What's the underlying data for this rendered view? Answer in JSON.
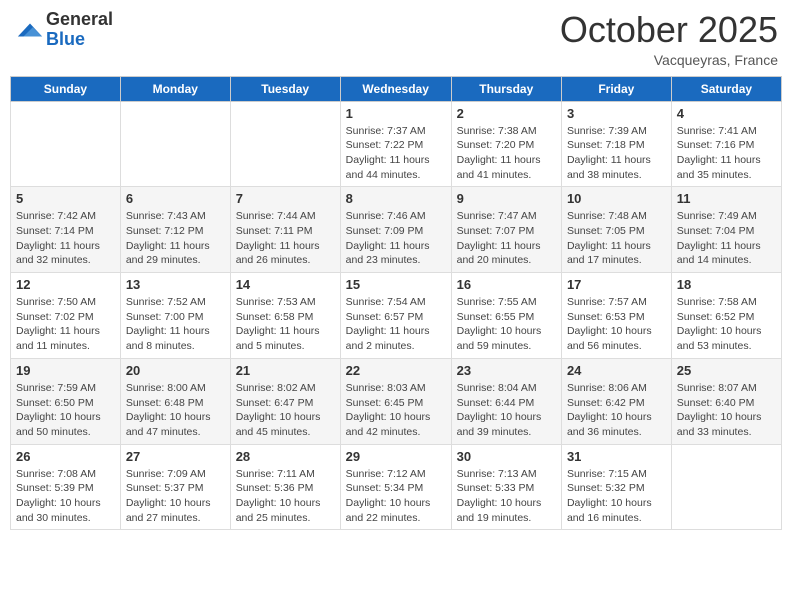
{
  "logo": {
    "general": "General",
    "blue": "Blue"
  },
  "header": {
    "month": "October 2025",
    "location": "Vacqueyras, France"
  },
  "weekdays": [
    "Sunday",
    "Monday",
    "Tuesday",
    "Wednesday",
    "Thursday",
    "Friday",
    "Saturday"
  ],
  "weeks": [
    [
      {
        "day": "",
        "info": ""
      },
      {
        "day": "",
        "info": ""
      },
      {
        "day": "",
        "info": ""
      },
      {
        "day": "1",
        "info": "Sunrise: 7:37 AM\nSunset: 7:22 PM\nDaylight: 11 hours and 44 minutes."
      },
      {
        "day": "2",
        "info": "Sunrise: 7:38 AM\nSunset: 7:20 PM\nDaylight: 11 hours and 41 minutes."
      },
      {
        "day": "3",
        "info": "Sunrise: 7:39 AM\nSunset: 7:18 PM\nDaylight: 11 hours and 38 minutes."
      },
      {
        "day": "4",
        "info": "Sunrise: 7:41 AM\nSunset: 7:16 PM\nDaylight: 11 hours and 35 minutes."
      }
    ],
    [
      {
        "day": "5",
        "info": "Sunrise: 7:42 AM\nSunset: 7:14 PM\nDaylight: 11 hours and 32 minutes."
      },
      {
        "day": "6",
        "info": "Sunrise: 7:43 AM\nSunset: 7:12 PM\nDaylight: 11 hours and 29 minutes."
      },
      {
        "day": "7",
        "info": "Sunrise: 7:44 AM\nSunset: 7:11 PM\nDaylight: 11 hours and 26 minutes."
      },
      {
        "day": "8",
        "info": "Sunrise: 7:46 AM\nSunset: 7:09 PM\nDaylight: 11 hours and 23 minutes."
      },
      {
        "day": "9",
        "info": "Sunrise: 7:47 AM\nSunset: 7:07 PM\nDaylight: 11 hours and 20 minutes."
      },
      {
        "day": "10",
        "info": "Sunrise: 7:48 AM\nSunset: 7:05 PM\nDaylight: 11 hours and 17 minutes."
      },
      {
        "day": "11",
        "info": "Sunrise: 7:49 AM\nSunset: 7:04 PM\nDaylight: 11 hours and 14 minutes."
      }
    ],
    [
      {
        "day": "12",
        "info": "Sunrise: 7:50 AM\nSunset: 7:02 PM\nDaylight: 11 hours and 11 minutes."
      },
      {
        "day": "13",
        "info": "Sunrise: 7:52 AM\nSunset: 7:00 PM\nDaylight: 11 hours and 8 minutes."
      },
      {
        "day": "14",
        "info": "Sunrise: 7:53 AM\nSunset: 6:58 PM\nDaylight: 11 hours and 5 minutes."
      },
      {
        "day": "15",
        "info": "Sunrise: 7:54 AM\nSunset: 6:57 PM\nDaylight: 11 hours and 2 minutes."
      },
      {
        "day": "16",
        "info": "Sunrise: 7:55 AM\nSunset: 6:55 PM\nDaylight: 10 hours and 59 minutes."
      },
      {
        "day": "17",
        "info": "Sunrise: 7:57 AM\nSunset: 6:53 PM\nDaylight: 10 hours and 56 minutes."
      },
      {
        "day": "18",
        "info": "Sunrise: 7:58 AM\nSunset: 6:52 PM\nDaylight: 10 hours and 53 minutes."
      }
    ],
    [
      {
        "day": "19",
        "info": "Sunrise: 7:59 AM\nSunset: 6:50 PM\nDaylight: 10 hours and 50 minutes."
      },
      {
        "day": "20",
        "info": "Sunrise: 8:00 AM\nSunset: 6:48 PM\nDaylight: 10 hours and 47 minutes."
      },
      {
        "day": "21",
        "info": "Sunrise: 8:02 AM\nSunset: 6:47 PM\nDaylight: 10 hours and 45 minutes."
      },
      {
        "day": "22",
        "info": "Sunrise: 8:03 AM\nSunset: 6:45 PM\nDaylight: 10 hours and 42 minutes."
      },
      {
        "day": "23",
        "info": "Sunrise: 8:04 AM\nSunset: 6:44 PM\nDaylight: 10 hours and 39 minutes."
      },
      {
        "day": "24",
        "info": "Sunrise: 8:06 AM\nSunset: 6:42 PM\nDaylight: 10 hours and 36 minutes."
      },
      {
        "day": "25",
        "info": "Sunrise: 8:07 AM\nSunset: 6:40 PM\nDaylight: 10 hours and 33 minutes."
      }
    ],
    [
      {
        "day": "26",
        "info": "Sunrise: 7:08 AM\nSunset: 5:39 PM\nDaylight: 10 hours and 30 minutes."
      },
      {
        "day": "27",
        "info": "Sunrise: 7:09 AM\nSunset: 5:37 PM\nDaylight: 10 hours and 27 minutes."
      },
      {
        "day": "28",
        "info": "Sunrise: 7:11 AM\nSunset: 5:36 PM\nDaylight: 10 hours and 25 minutes."
      },
      {
        "day": "29",
        "info": "Sunrise: 7:12 AM\nSunset: 5:34 PM\nDaylight: 10 hours and 22 minutes."
      },
      {
        "day": "30",
        "info": "Sunrise: 7:13 AM\nSunset: 5:33 PM\nDaylight: 10 hours and 19 minutes."
      },
      {
        "day": "31",
        "info": "Sunrise: 7:15 AM\nSunset: 5:32 PM\nDaylight: 10 hours and 16 minutes."
      },
      {
        "day": "",
        "info": ""
      }
    ]
  ]
}
